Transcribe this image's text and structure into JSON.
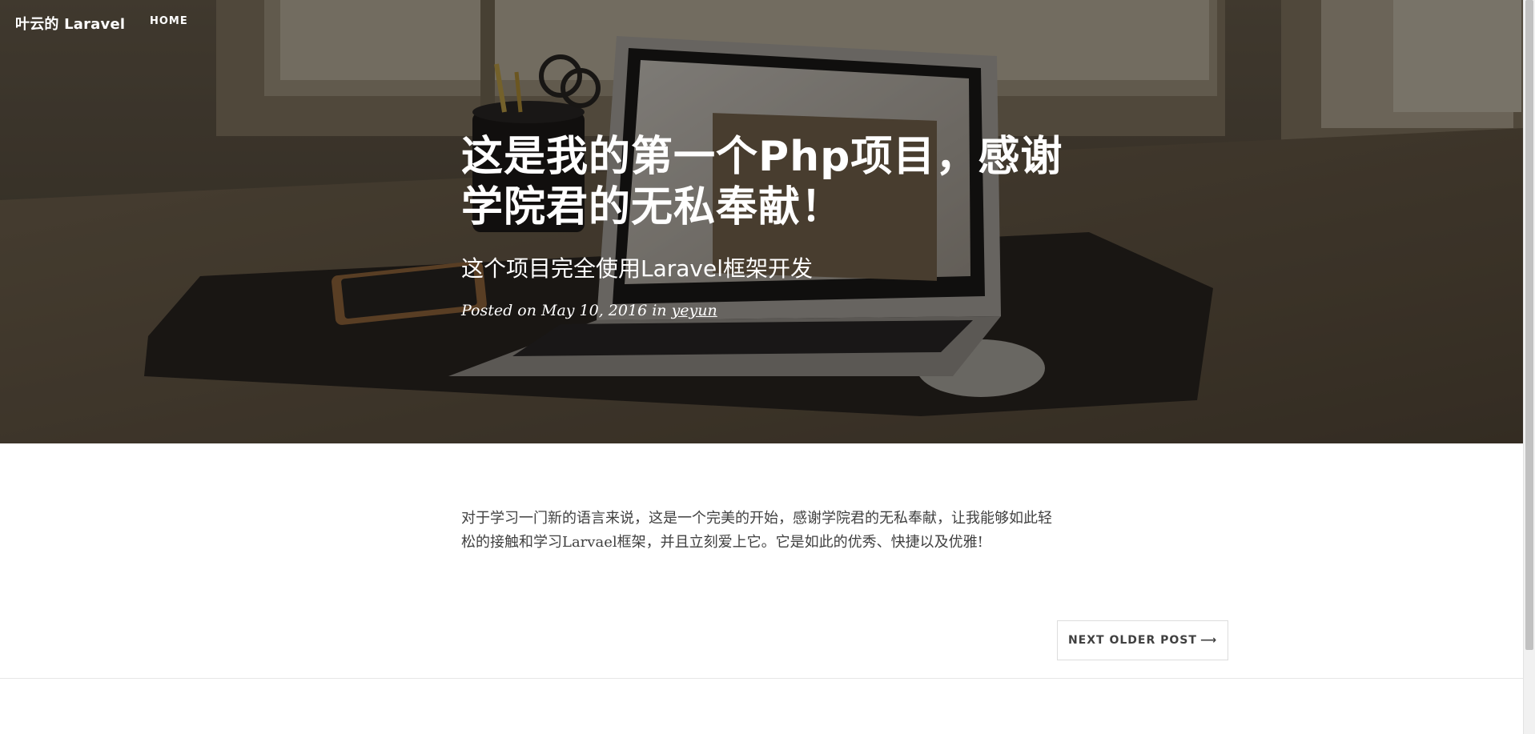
{
  "navbar": {
    "brand": "叶云的 Laravel",
    "home_label": "HOME"
  },
  "post": {
    "title": "这是我的第一个Php项目，感谢学院君的无私奉献！",
    "subtitle": "这个项目完全使用Laravel框架开发",
    "meta_prefix": "Posted on May 10, 2016 in",
    "author": "yeyun",
    "body": "对于学习一门新的语言来说，这是一个完美的开始，感谢学院君的无私奉献，让我能够如此轻松的接触和学习Larvael框架，并且立刻爱上它。它是如此的优秀、快捷以及优雅!"
  },
  "pager": {
    "next_label": "NEXT OLDER POST",
    "next_arrow": "⟶"
  },
  "colors": {
    "text_body": "#404040",
    "hero_overlay": "#000000",
    "border": "#dddddd"
  },
  "hero_image": {
    "icon": "laptop-desk-photo"
  }
}
